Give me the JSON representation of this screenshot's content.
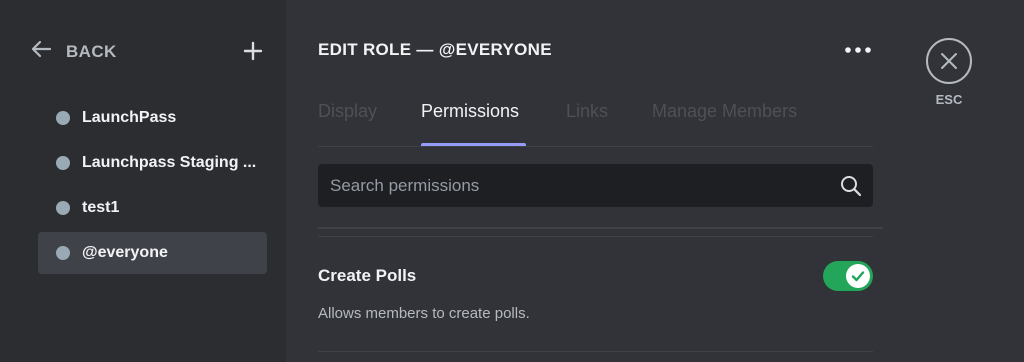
{
  "sidebar": {
    "back_label": "BACK",
    "roles": [
      {
        "label": "LaunchPass",
        "selected": false
      },
      {
        "label": "Launchpass Staging ...",
        "selected": false
      },
      {
        "label": "test1",
        "selected": false
      },
      {
        "label": "@everyone",
        "selected": true
      }
    ],
    "role_dot_color": "#99aab5"
  },
  "header": {
    "title": "EDIT ROLE — @EVERYONE"
  },
  "tabs": [
    {
      "label": "Display",
      "active": false
    },
    {
      "label": "Permissions",
      "active": true
    },
    {
      "label": "Links",
      "active": false
    },
    {
      "label": "Manage Members",
      "active": false
    }
  ],
  "search": {
    "placeholder": "Search permissions",
    "value": ""
  },
  "permission": {
    "title": "Create Polls",
    "description": "Allows members to create polls.",
    "enabled": true,
    "toggle_color": "#23a55a"
  },
  "close": {
    "label": "ESC"
  },
  "colors": {
    "accent": "#949cf7",
    "background": "#313338",
    "sidebar": "#2b2d31"
  }
}
